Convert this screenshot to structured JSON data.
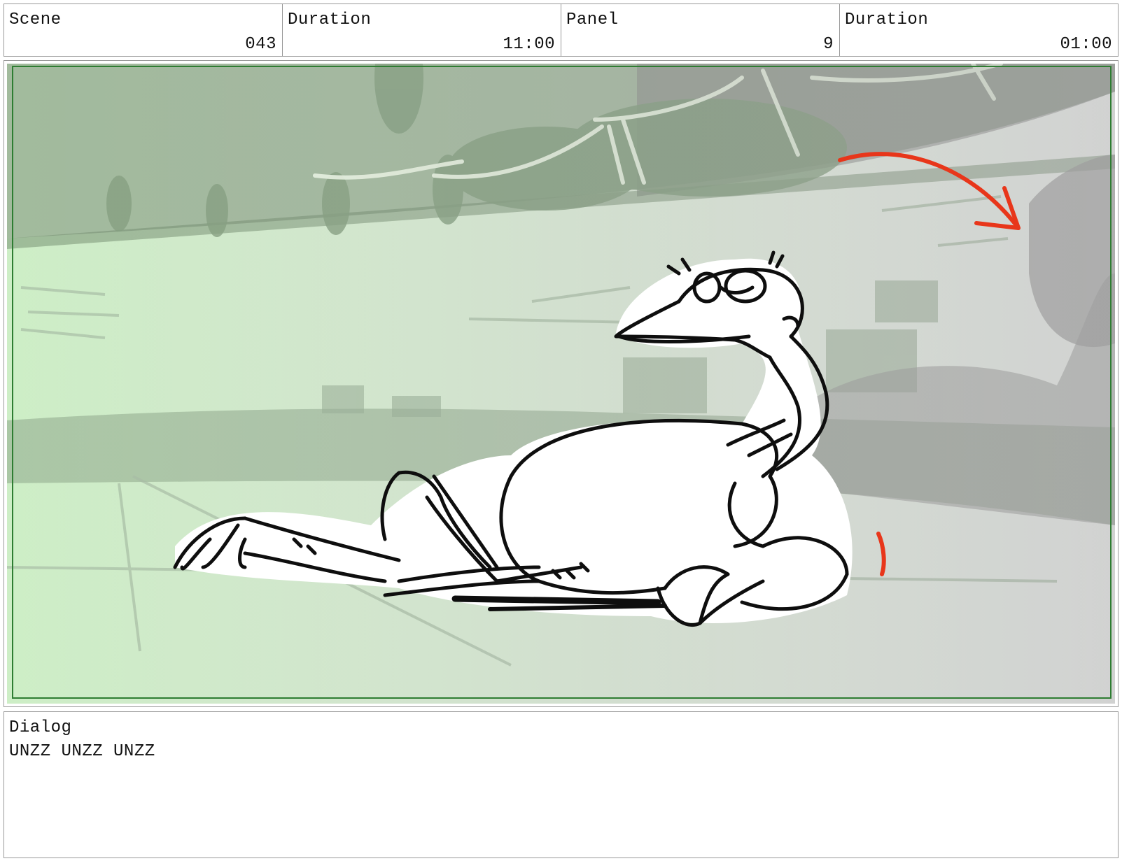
{
  "header": {
    "scene": {
      "label": "Scene",
      "value": "043"
    },
    "scene_duration": {
      "label": "Duration",
      "value": "11:00"
    },
    "panel": {
      "label": "Panel",
      "value": "9"
    },
    "panel_duration": {
      "label": "Duration",
      "value": "01:00"
    }
  },
  "dialog": {
    "label": "Dialog",
    "text": "UNZZ UNZZ UNZZ"
  },
  "colors": {
    "safe_frame": "#2e7d32",
    "tint_green": "#cdeec6",
    "foliage": "#8fa88a",
    "shadow_gray": "#9e9e9e",
    "motion_arrow": "#e8361a"
  },
  "icons": [
    "motion-arrow-icon"
  ]
}
